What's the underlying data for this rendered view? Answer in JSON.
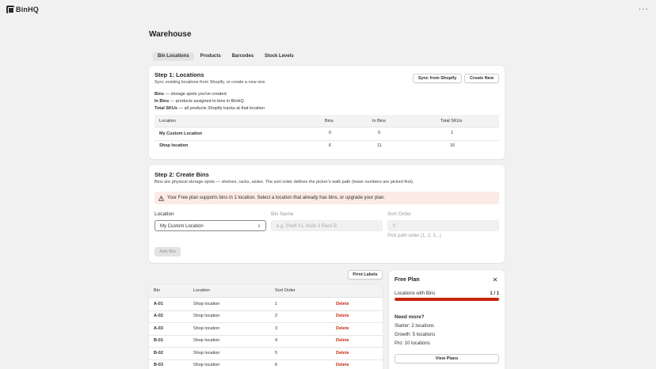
{
  "app": {
    "logo_text": "BinHQ",
    "more_icon": "ellipsis-icon"
  },
  "page": {
    "title": "Warehouse"
  },
  "tabs": [
    {
      "label": "Bin Locations",
      "active": true
    },
    {
      "label": "Products",
      "active": false
    },
    {
      "label": "Barcodes",
      "active": false
    },
    {
      "label": "Stock Levels",
      "active": false
    }
  ],
  "step1": {
    "title": "Step 1: Locations",
    "subtitle": "Sync existing locations from Shopify, or create a new one.",
    "sync_label": "Sync from Shopify",
    "create_label": "Create New",
    "info": [
      {
        "term": "Bins",
        "text": " — storage spots you've created"
      },
      {
        "term": "In Bins",
        "text": " — products assigned to bins in BinHQ"
      },
      {
        "term": "Total SKUs",
        "text": " — all products Shopify tracks at that location"
      }
    ],
    "columns": [
      "Location",
      "Bins",
      "In Bins",
      "Total SKUs"
    ],
    "rows": [
      {
        "location": "My Custom Location",
        "bins": "0",
        "in_bins": "0",
        "total_skus": "1"
      },
      {
        "location": "Shop location",
        "bins": "6",
        "in_bins": "11",
        "total_skus": "16"
      }
    ]
  },
  "step2": {
    "title": "Step 2: Create Bins",
    "subtitle": "Bins are physical storage spots — shelves, racks, aisles. The sort order defines the picker's walk path (lower numbers are picked first).",
    "alert_icon": "warning-triangle-icon",
    "alert_text": "Your Free plan supports bins in 1 location. Select a location that already has bins, or upgrade your plan.",
    "location_label": "Location",
    "location_value": "My Custom Location",
    "bin_name_label": "Bin Name",
    "bin_name_placeholder": "e.g. Shelf A1, Aisle 3 Rack B",
    "sort_order_label": "Sort Order",
    "sort_order_placeholder": "0",
    "sort_order_hint": "Pick path order (1, 2, 3...)",
    "add_label": "Add Bin"
  },
  "bins_table": {
    "print_label": "Print Labels",
    "columns": [
      "Bin",
      "Location",
      "Sort Order",
      ""
    ],
    "delete_label": "Delete",
    "rows": [
      {
        "bin": "A-01",
        "location": "Shop location",
        "sort": "1"
      },
      {
        "bin": "A-02",
        "location": "Shop location",
        "sort": "2"
      },
      {
        "bin": "A-03",
        "location": "Shop location",
        "sort": "3"
      },
      {
        "bin": "B-01",
        "location": "Shop location",
        "sort": "4"
      },
      {
        "bin": "B-02",
        "location": "Shop location",
        "sort": "5"
      },
      {
        "bin": "B-03",
        "location": "Shop location",
        "sort": "6"
      }
    ]
  },
  "plan": {
    "title": "Free Plan",
    "close_icon": "close-icon",
    "usage_label": "Locations with Bins",
    "usage_value": "1 / 1",
    "usage_fraction": 1.0,
    "bar_color": "#c5280c",
    "need_more": "Need more?",
    "tiers": [
      "Starter: 2 locations",
      "Growth: 5 locations",
      "Pro: 10 locations"
    ],
    "view_label": "View Plans"
  }
}
